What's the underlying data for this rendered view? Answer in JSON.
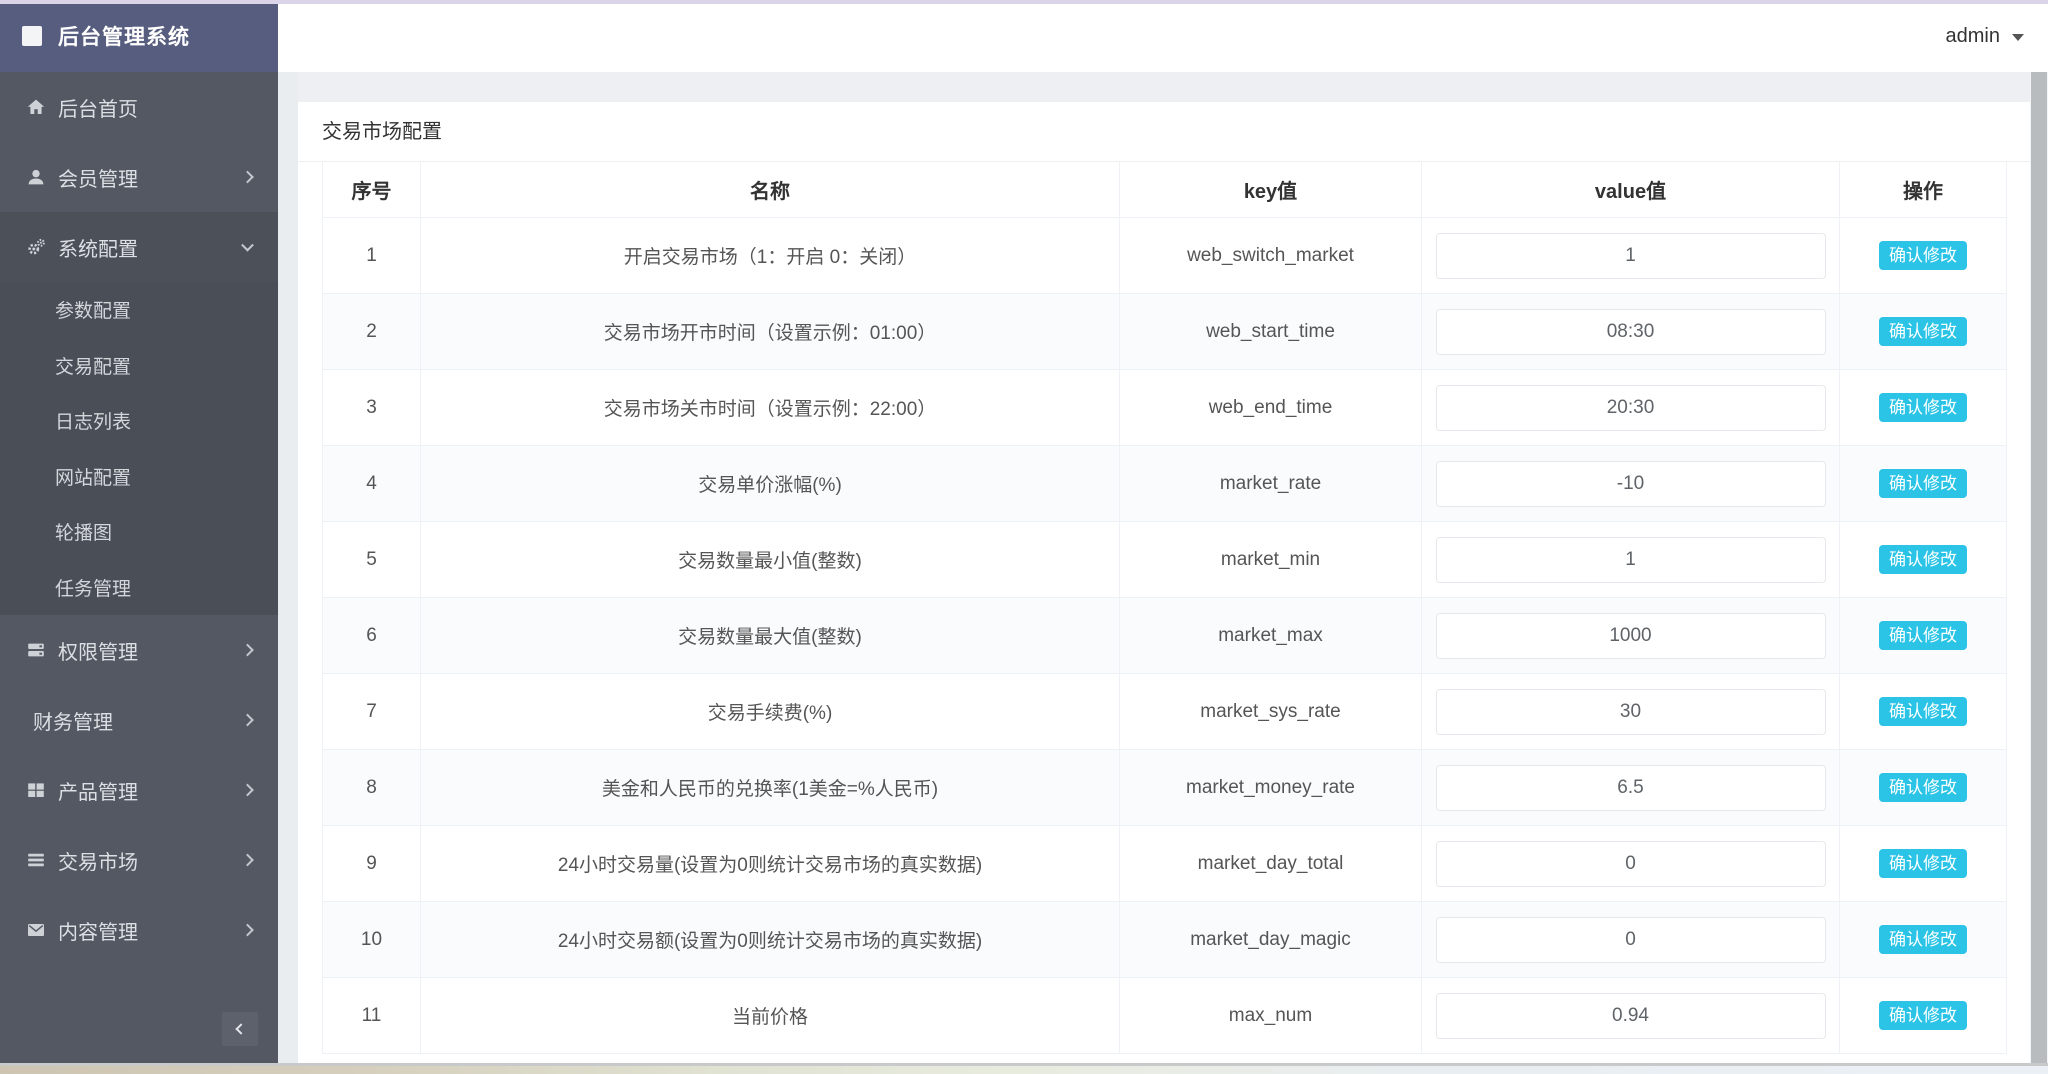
{
  "app": {
    "title": "后台管理系统"
  },
  "header": {
    "user": "admin"
  },
  "sidebar": {
    "items": [
      {
        "type": "item",
        "label": "后台首页",
        "icon": "home-icon",
        "chevron": ""
      },
      {
        "type": "item",
        "label": "会员管理",
        "icon": "user-icon",
        "chevron": "right"
      },
      {
        "type": "item",
        "label": "系统配置",
        "icon": "gears-icon",
        "chevron": "down",
        "active": true
      },
      {
        "type": "subitem",
        "label": "参数配置"
      },
      {
        "type": "subitem",
        "label": "交易配置"
      },
      {
        "type": "subitem",
        "label": "日志列表"
      },
      {
        "type": "subitem",
        "label": "网站配置"
      },
      {
        "type": "subitem",
        "label": "轮播图"
      },
      {
        "type": "subitem",
        "label": "任务管理"
      },
      {
        "type": "item",
        "label": "权限管理",
        "icon": "server-icon",
        "chevron": "right"
      },
      {
        "type": "item",
        "label": "财务管理",
        "icon": "",
        "chevron": "right"
      },
      {
        "type": "item",
        "label": "产品管理",
        "icon": "windows-icon",
        "chevron": "right"
      },
      {
        "type": "item",
        "label": "交易市场",
        "icon": "list-icon",
        "chevron": "right"
      },
      {
        "type": "item",
        "label": "内容管理",
        "icon": "envelope-icon",
        "chevron": "right"
      }
    ]
  },
  "page": {
    "title": "交易市场配置"
  },
  "table": {
    "columns": [
      "序号",
      "名称",
      "key值",
      "value值",
      "操作"
    ],
    "button_label": "确认修改",
    "rows": [
      {
        "no": "1",
        "name": "开启交易市场（1：开启 0：关闭）",
        "key": "web_switch_market",
        "value": "1"
      },
      {
        "no": "2",
        "name": "交易市场开市时间（设置示例：01:00）",
        "key": "web_start_time",
        "value": "08:30"
      },
      {
        "no": "3",
        "name": "交易市场关市时间（设置示例：22:00）",
        "key": "web_end_time",
        "value": "20:30"
      },
      {
        "no": "4",
        "name": "交易单价涨幅(%)",
        "key": "market_rate",
        "value": "-10"
      },
      {
        "no": "5",
        "name": "交易数量最小值(整数)",
        "key": "market_min",
        "value": "1"
      },
      {
        "no": "6",
        "name": "交易数量最大值(整数)",
        "key": "market_max",
        "value": "1000"
      },
      {
        "no": "7",
        "name": "交易手续费(%)",
        "key": "market_sys_rate",
        "value": "30"
      },
      {
        "no": "8",
        "name": "美金和人民币的兑换率(1美金=%人民币)",
        "key": "market_money_rate",
        "value": "6.5"
      },
      {
        "no": "9",
        "name": "24小时交易量(设置为0则统计交易市场的真实数据)",
        "key": "market_day_total",
        "value": "0"
      },
      {
        "no": "10",
        "name": "24小时交易额(设置为0则统计交易市场的真实数据)",
        "key": "market_day_magic",
        "value": "0"
      },
      {
        "no": "11",
        "name": "当前价格",
        "key": "max_num",
        "value": "0.94"
      }
    ]
  },
  "colors": {
    "accent_button": "#2bc4e6",
    "sidebar_bg": "#535862",
    "sidebar_header_bg": "#575d7e",
    "sidebar_active_bg": "#4b5059",
    "submenu_bg": "#494e57",
    "content_band": "#edeff2",
    "row_stripe": "#fafbfd",
    "table_border": "#eef1f5",
    "top_strip": "#dbd5e9"
  }
}
